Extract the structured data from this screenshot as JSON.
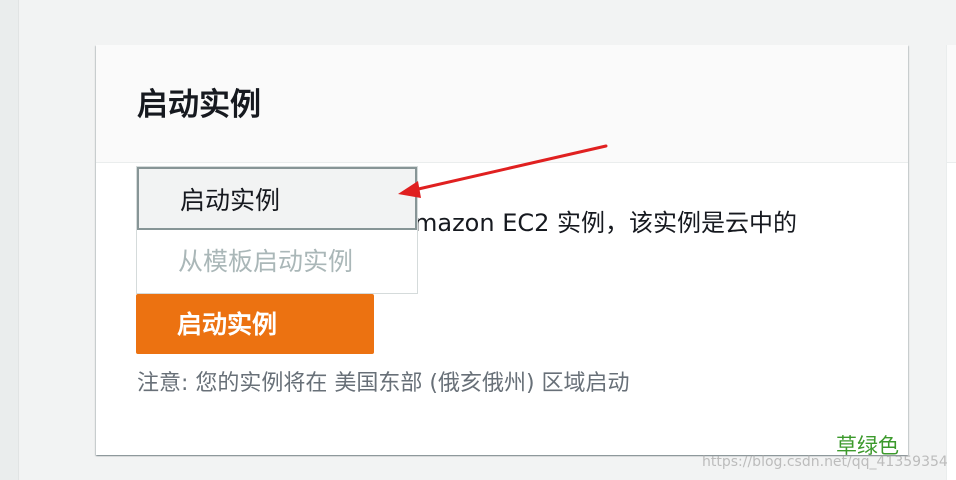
{
  "card": {
    "title": "启动实例",
    "description_tail": "mazon EC2 实例，该实例是云中的",
    "note": "注意: 您的实例将在 美国东部 (俄亥俄州) 区域启动"
  },
  "dropdown": {
    "items": [
      {
        "label": "启动实例",
        "state": "highlighted"
      },
      {
        "label": "从模板启动实例",
        "state": "disabled"
      }
    ]
  },
  "launch_button": {
    "label": "启动实例",
    "icon": "caret-up-icon",
    "color": "#ec7211"
  },
  "annotations": {
    "arrow_color": "#e02020",
    "green_label": "草绿色",
    "green_color": "#3c9a2c"
  },
  "watermark": "https://blog.csdn.net/qq_41359354"
}
